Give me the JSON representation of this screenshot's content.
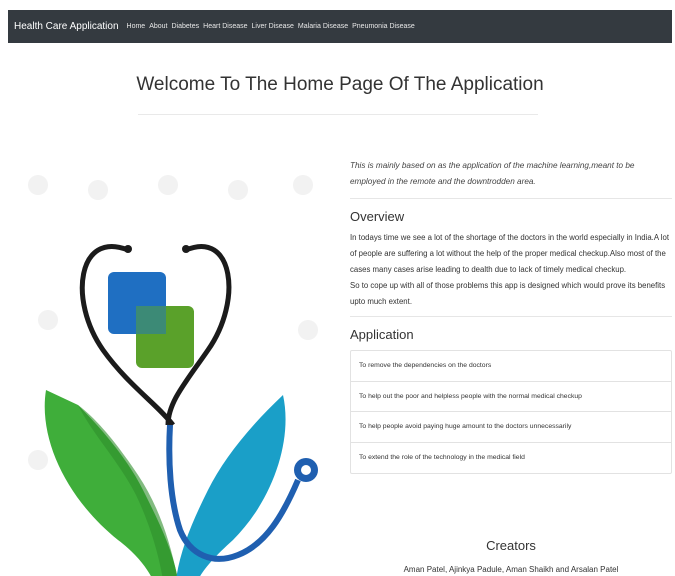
{
  "navbar": {
    "brand": "Health Care Application",
    "links": [
      "Home",
      "About",
      "Diabetes",
      "Heart Disease",
      "Liver Disease",
      "Malaria Disease",
      "Pneumonia Disease"
    ]
  },
  "main": {
    "title": "Welcome To The Home Page Of The Application",
    "lead": "This is mainly based on as the application of the machine learning,meant to be employed in the remote and the downtrodden area.",
    "overview": {
      "heading": "Overview",
      "paragraph_1": "In todays time we see a lot of the shortage of the doctors in the world especially in India.A lot of people are suffering a lot without the help of the proper medical checkup.Also most of the cases many cases arise leading to dealth due to lack of timely medical checkup.",
      "paragraph_2": "So to cope up with all of those problems this app is designed which would prove its benefits upto much extent."
    },
    "application": {
      "heading": "Application",
      "items": [
        "To remove the dependencies on the doctors",
        "To help out the poor and helpless people with the normal medical checkup",
        "To help people avoid paying huge amount to the doctors unnecessarily",
        "To extend the role of the technology in the medical field"
      ]
    },
    "creators": {
      "heading": "Creators",
      "names": "Aman Patel, Ajinkya Padule, Aman Shaikh and Arsalan Patel"
    }
  },
  "colors": {
    "navbar": "#343a40",
    "medical_blue": "#1f6fc2",
    "medical_green": "#5aa12a",
    "hand_teal": "#1a9fc8",
    "hand_green": "#3fae3a"
  },
  "icons": {
    "logo": "medical-heart-stethoscope-icon"
  }
}
